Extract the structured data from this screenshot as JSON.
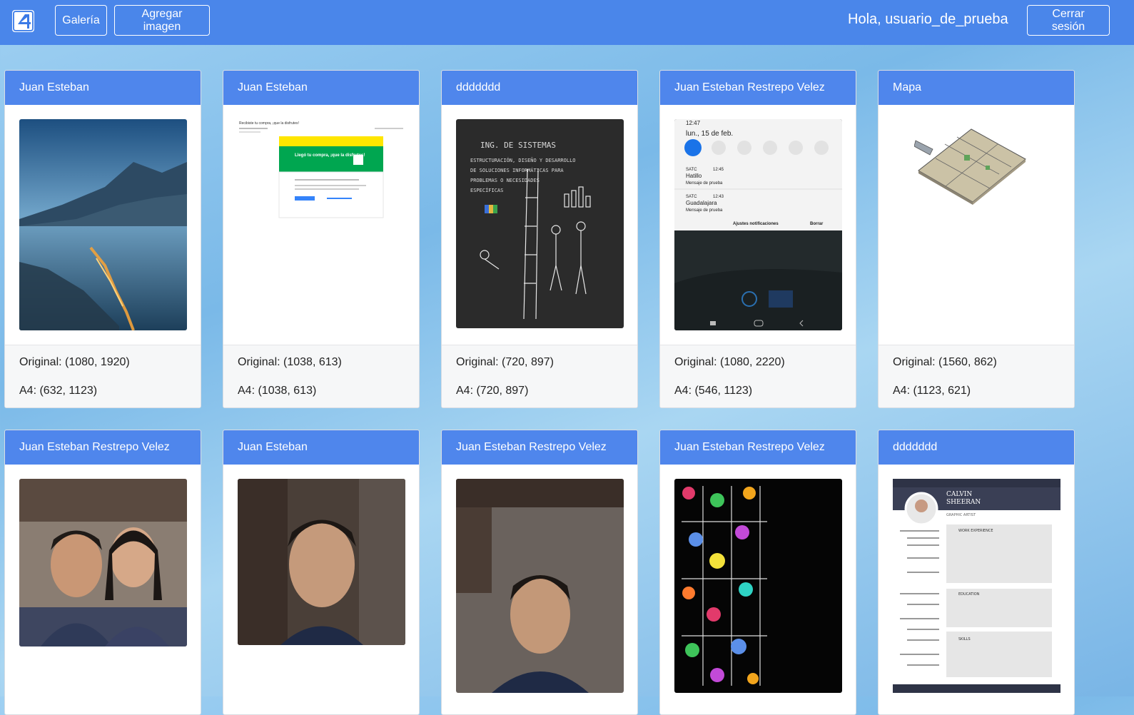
{
  "navbar": {
    "logo_alt": "4",
    "gallery_label": "Galería",
    "add_image_label": "Agregar imagen",
    "greeting": "Hola, usuario_de_prueba",
    "logout_label": "Cerrar sesión"
  },
  "cards": [
    {
      "title": "Juan Esteban",
      "original": "Original: (1080, 1920)",
      "a4": "A4: (632, 1123)"
    },
    {
      "title": "Juan Esteban",
      "original": "Original: (1038, 613)",
      "a4": "A4: (1038, 613)"
    },
    {
      "title": "ddddddd",
      "original": "Original: (720, 897)",
      "a4": "A4: (720, 897)"
    },
    {
      "title": "Juan Esteban Restrepo Velez",
      "original": "Original: (1080, 2220)",
      "a4": "A4: (546, 1123)"
    },
    {
      "title": "Mapa",
      "original": "Original: (1560, 862)",
      "a4": "A4: (1123, 621)"
    },
    {
      "title": "Juan Esteban Restrepo Velez"
    },
    {
      "title": "Juan Esteban"
    },
    {
      "title": "Juan Esteban Restrepo Velez"
    },
    {
      "title": "Juan Esteban Restrepo Velez"
    },
    {
      "title": "ddddddd"
    }
  ],
  "image_texts": {
    "phone_time": "12:47",
    "phone_date": "lun., 15 de feb.",
    "notif1_app": "SATC",
    "notif1_time": "12:45",
    "notif1_title": "Hatillo",
    "notif1_msg": "Mensaje de prueba",
    "notif2_app": "SATC",
    "notif2_time": "12:43",
    "notif2_title": "Guadalajara",
    "notif2_msg": "Mensaje de prueba",
    "notif_settings": "Ajustes notificaciones",
    "notif_clear": "Borrar",
    "chalk_line1": "ING. DE SISTEMAS",
    "chalk_line2": "ESTRUCTURACIÓN, DISEÑO Y DESARROLLO",
    "chalk_line3": "DE SOLUCIONES INFORMÁTICAS PARA",
    "chalk_line4": "PROBLEMAS O NECESIDADES",
    "chalk_line5": "ESPECÍFICAS",
    "receipt_title": "Recibiste tu compra, ¡que la disfrutes!",
    "receipt_headline": "Llegó tu compra, ¡que la disfrutes!",
    "resume_name1": "CALVIN",
    "resume_name2": "SHEERAN",
    "resume_role": "GRAPHIC ARTIST",
    "resume_exp": "WORK EXPERIENCE",
    "resume_edu": "EDUCATION",
    "resume_skills": "SKILLS"
  }
}
